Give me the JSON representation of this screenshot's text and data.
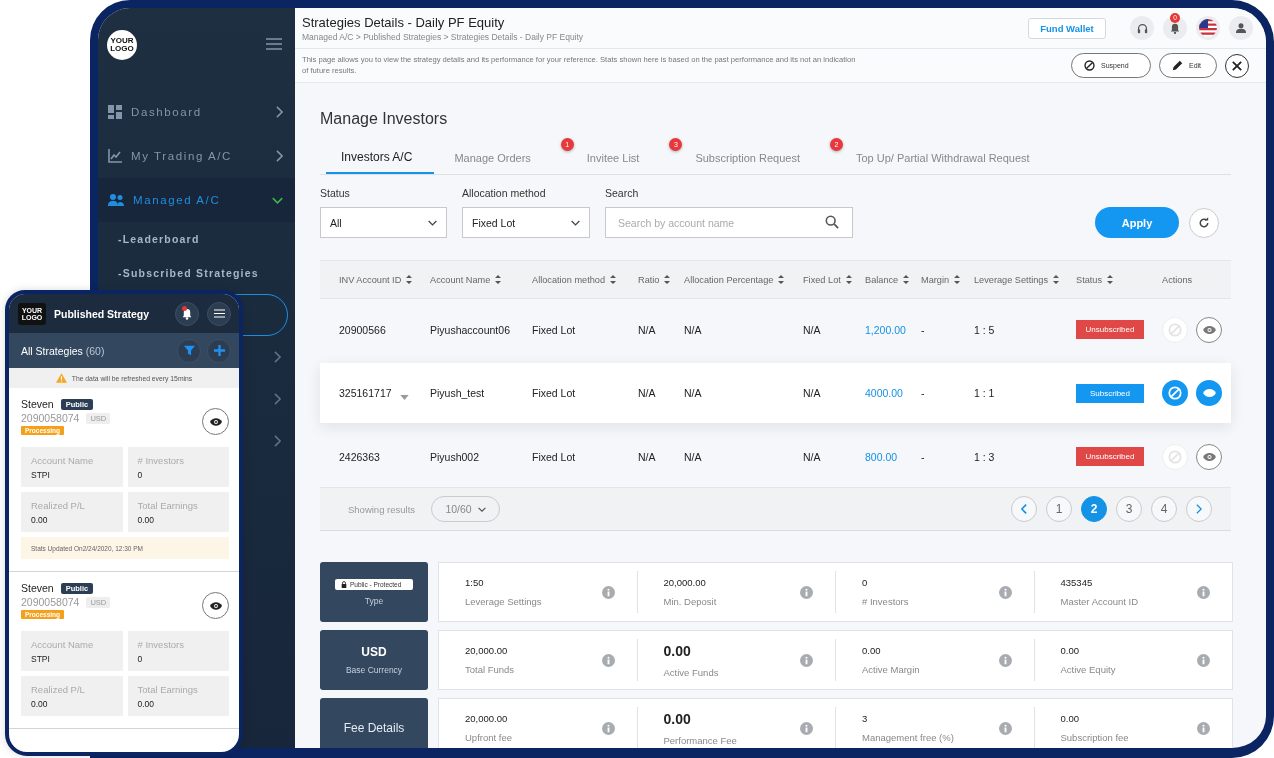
{
  "sidebar": {
    "logo": "YOUR LOGO",
    "items": [
      {
        "label": "Dashboard",
        "selected": false,
        "expanded": false
      },
      {
        "label": "My Trading A/C",
        "selected": false,
        "expanded": false
      },
      {
        "label": "Managed A/C",
        "selected": true,
        "expanded": true,
        "children": [
          {
            "label": "-Leaderboard",
            "selected": false
          },
          {
            "label": "-Subscribed Strategies",
            "selected": false
          },
          {
            "selected": true
          }
        ]
      },
      {
        "expanded": false
      },
      {
        "expanded": false
      },
      {
        "expanded": false
      }
    ]
  },
  "header": {
    "title": "Strategies Details - Daily PF Equity",
    "breadcrumb": "Managed A/C > Published Strategies > Strategies Details - Daily PF Equity",
    "fund_wallet": "Fund Wallet",
    "notification_count": "0",
    "description": "This page allows you to view the strategy details and its performance for your reference. Stats shown here is based on the past performance and its not an indication of future results.",
    "actions": [
      {
        "label": "Suspend"
      },
      {
        "label": "Edit"
      }
    ]
  },
  "investors": {
    "title": "Manage Investors",
    "tabs": [
      {
        "label": "Investors A/C",
        "selected": true
      },
      {
        "label": "Manage Orders",
        "selected": false
      },
      {
        "label": "Invitee List",
        "selected": false,
        "badge": "1"
      },
      {
        "label": "Subscription Request",
        "selected": false,
        "badge": "3"
      },
      {
        "label": "Top Up/ Partial Withdrawal Request",
        "selected": false,
        "badge": "2"
      }
    ],
    "filters": {
      "status_label": "Status",
      "status": "All",
      "allocation_label": "Allocation method",
      "allocation": "Fixed Lot",
      "search_label": "Search",
      "search_placeholder": "Search by account name",
      "apply": "Apply"
    },
    "table": {
      "columns": [
        "INV Account ID",
        "Account Name",
        "Allocation method",
        "Ratio",
        "Allocation Percentage",
        "Fixed Lot",
        "Balance",
        "Margin",
        "Leverage Settings",
        "Status",
        "Actions"
      ],
      "rows": [
        {
          "cells": [
            "20900566",
            "Piyushaccount06",
            "Fixed Lot",
            "N/A",
            "N/A",
            "N/A",
            "1,200.00",
            "-",
            "1 : 5"
          ],
          "status": "Unsubscribed",
          "subscribed": false,
          "selected": false,
          "expandable": false
        },
        {
          "cells": [
            "325161717",
            "Piyush_test",
            "Fixed Lot",
            "N/A",
            "N/A",
            "N/A",
            "4000.00",
            "-",
            "1 : 1"
          ],
          "status": "Subscribed",
          "subscribed": true,
          "selected": true,
          "expandable": true
        },
        {
          "cells": [
            "2426363",
            "Piyush002",
            "Fixed Lot",
            "N/A",
            "N/A",
            "N/A",
            "800.00",
            "-",
            "1 : 3"
          ],
          "status": "Unsubscribed",
          "subscribed": false,
          "selected": false,
          "expandable": false
        }
      ]
    },
    "pagination": {
      "label": "Showing results",
      "page_size": "10/60",
      "pages": [
        {
          "label": "1",
          "selected": false
        },
        {
          "label": "2",
          "selected": true
        },
        {
          "label": "3",
          "selected": false
        },
        {
          "label": "4",
          "selected": false
        }
      ]
    }
  },
  "stats": {
    "rows": [
      {
        "kind": "type",
        "badge": "Public - Protected",
        "caption": "Type",
        "cells": [
          {
            "value": "1:50",
            "label": "Leverage Settings",
            "emphasis": false
          },
          {
            "value": "20,000.00",
            "label": "Min. Deposit",
            "emphasis": false
          },
          {
            "value": "0",
            "label": "# Investors",
            "emphasis": false
          },
          {
            "value": "435345",
            "label": "Master Account ID",
            "emphasis": false
          }
        ]
      },
      {
        "kind": "currency",
        "value": "USD",
        "caption": "Base Currency",
        "cells": [
          {
            "value": "20,000.00",
            "label": "Total Funds",
            "emphasis": false
          },
          {
            "value": "0.00",
            "label": "Active Funds",
            "emphasis": true
          },
          {
            "value": "0.00",
            "label": "Active Margin",
            "emphasis": false
          },
          {
            "value": "0.00",
            "label": "Active Equity",
            "emphasis": false
          }
        ]
      },
      {
        "kind": "title",
        "caption": "Fee Details",
        "cells": [
          {
            "value": "20,000.00",
            "label": "Upfront fee",
            "emphasis": false
          },
          {
            "value": "0.00",
            "label": "Performance Fee",
            "emphasis": true
          },
          {
            "value": "3",
            "label": "Management free (%)",
            "emphasis": false
          },
          {
            "value": "0.00",
            "label": "Subscription fee",
            "emphasis": false
          }
        ]
      }
    ]
  },
  "phone": {
    "logo": "YOUR LOGO",
    "title": "Published Strategy",
    "bell_alert": true,
    "list_title": "All Strategies",
    "count": "(60)",
    "notice": "The data will be refreshed every 15mins",
    "cards": [
      {
        "name": "Steven",
        "visibility": "Public",
        "account": "2090058074",
        "currency": "USD",
        "status": "Processing",
        "fields": [
          {
            "label": "Account Name",
            "value": "STPI"
          },
          {
            "label": "# Investors",
            "value": "0"
          },
          {
            "label": "Realized P/L",
            "value": "0.00"
          },
          {
            "label": "Total Earnings",
            "value": "0.00"
          }
        ],
        "updated": "Stats Updated On2/24/2020, 12:30 PM"
      },
      {
        "name": "Steven",
        "visibility": "Public",
        "account": "2090058074",
        "currency": "USD",
        "status": "Processing",
        "fields": [
          {
            "label": "Account Name",
            "value": "STPI"
          },
          {
            "label": "# Investors",
            "value": "0"
          },
          {
            "label": "Realized P/L",
            "value": "0.00"
          },
          {
            "label": "Total Earnings",
            "value": "0.00"
          }
        ]
      }
    ]
  }
}
